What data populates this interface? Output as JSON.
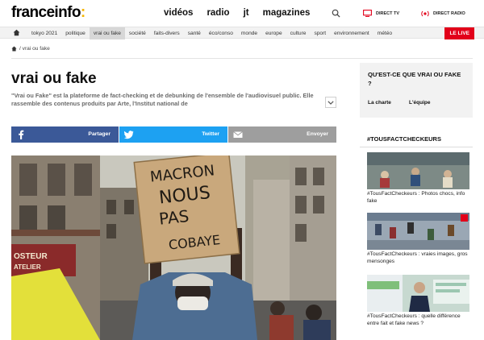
{
  "header": {
    "logo_text": "franceinfo",
    "logo_colon": ":",
    "nav": [
      "vidéos",
      "radio",
      "jt",
      "magazines"
    ],
    "direct_tv": "DIRECT TV",
    "direct_radio": "DIRECT RADIO"
  },
  "subnav": {
    "items": [
      "tokyo 2021",
      "politique",
      "vrai ou fake",
      "société",
      "faits-divers",
      "santé",
      "éco/conso",
      "monde",
      "europe",
      "culture",
      "sport",
      "environnement",
      "météo"
    ],
    "active_index": 2,
    "live": "LE LIVE"
  },
  "breadcrumb": "/ vrai ou fake",
  "main": {
    "title": "vrai ou fake",
    "intro": "\"Vrai ou Fake\" est la plateforme de fact-checking et de debunking de l'ensemble de l'audiovisuel public. Elle rassemble des contenus produits par Arte, l'Institut national de",
    "share": {
      "facebook": "Partager",
      "twitter": "Twitter",
      "email": "Envoyer"
    },
    "sign_lines": [
      "MACRON",
      "NOUS",
      "PAS",
      "COBAYE"
    ]
  },
  "sidebar": {
    "box_title": "QU'EST-CE QUE VRAI OU FAKE ?",
    "link_charte": "La charte",
    "link_equipe": "L'équipe",
    "tag_title": "#TOUSFACTCHECKEURS",
    "cards": [
      {
        "title": "#TousFactCheckeurs : Photos chocs, info fake"
      },
      {
        "title": "#TousFactCheckeurs : vraies images, gros mensonges"
      },
      {
        "title": "#TousFactCheckeurs : quelle différence entre fait et fake news ?"
      }
    ]
  },
  "colors": {
    "accent": "#f5b400",
    "live": "#e2001a",
    "facebook": "#3b5998",
    "twitter": "#1da1f2"
  }
}
